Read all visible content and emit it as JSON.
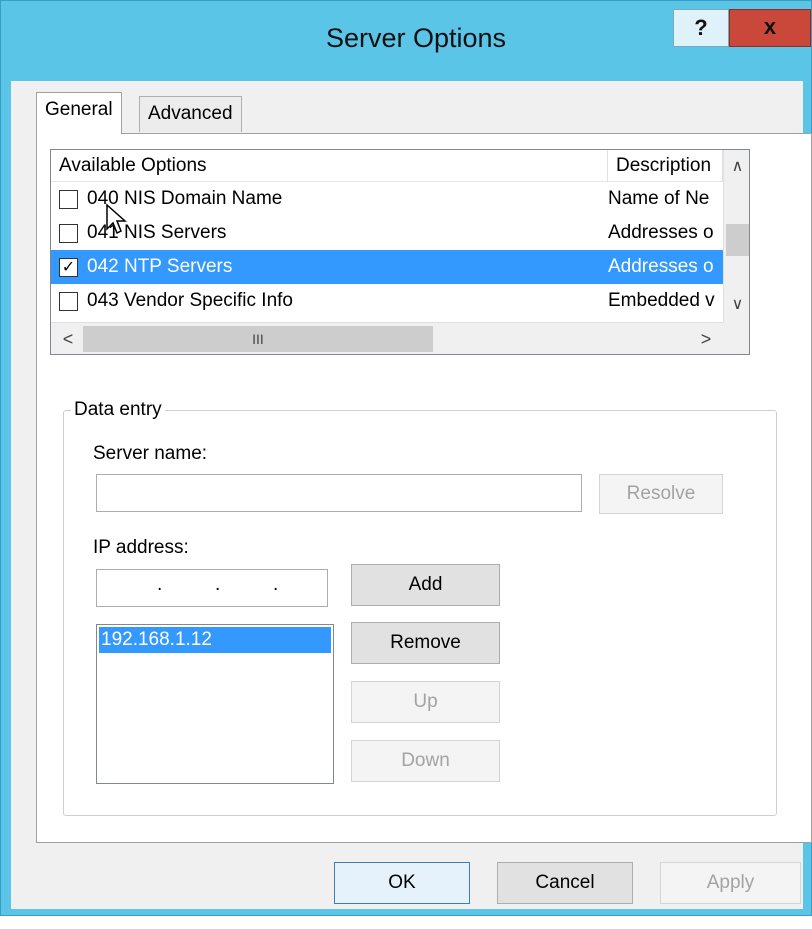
{
  "window": {
    "title": "Server Options",
    "help_label": "?",
    "close_label": "x"
  },
  "tabs": [
    {
      "label": "General",
      "active": true
    },
    {
      "label": "Advanced",
      "active": false
    }
  ],
  "options_list": {
    "columns": [
      "Available Options",
      "Description"
    ],
    "rows": [
      {
        "checked": false,
        "name": "040 NIS Domain Name",
        "description": "Name of Ne",
        "selected": false
      },
      {
        "checked": false,
        "name": "041 NIS Servers",
        "description": "Addresses o",
        "selected": false
      },
      {
        "checked": true,
        "name": "042 NTP Servers",
        "description": "Addresses o",
        "selected": true
      },
      {
        "checked": false,
        "name": "043 Vendor Specific Info",
        "description": "Embedded v",
        "selected": false
      }
    ],
    "scroll_up": "∧",
    "scroll_down": "∨",
    "scroll_left": "<",
    "scroll_right": ">",
    "scroll_grip": "III",
    "check_mark": "✓"
  },
  "data_entry": {
    "legend": "Data entry",
    "server_name_label": "Server name:",
    "server_name_value": "",
    "resolve_label": "Resolve",
    "ip_address_label": "IP address:",
    "ip_dots": [
      ".",
      ".",
      "."
    ],
    "add_label": "Add",
    "remove_label": "Remove",
    "up_label": "Up",
    "down_label": "Down",
    "ip_list": [
      "192.168.1.12"
    ]
  },
  "footer": {
    "ok_label": "OK",
    "cancel_label": "Cancel",
    "apply_label": "Apply"
  }
}
